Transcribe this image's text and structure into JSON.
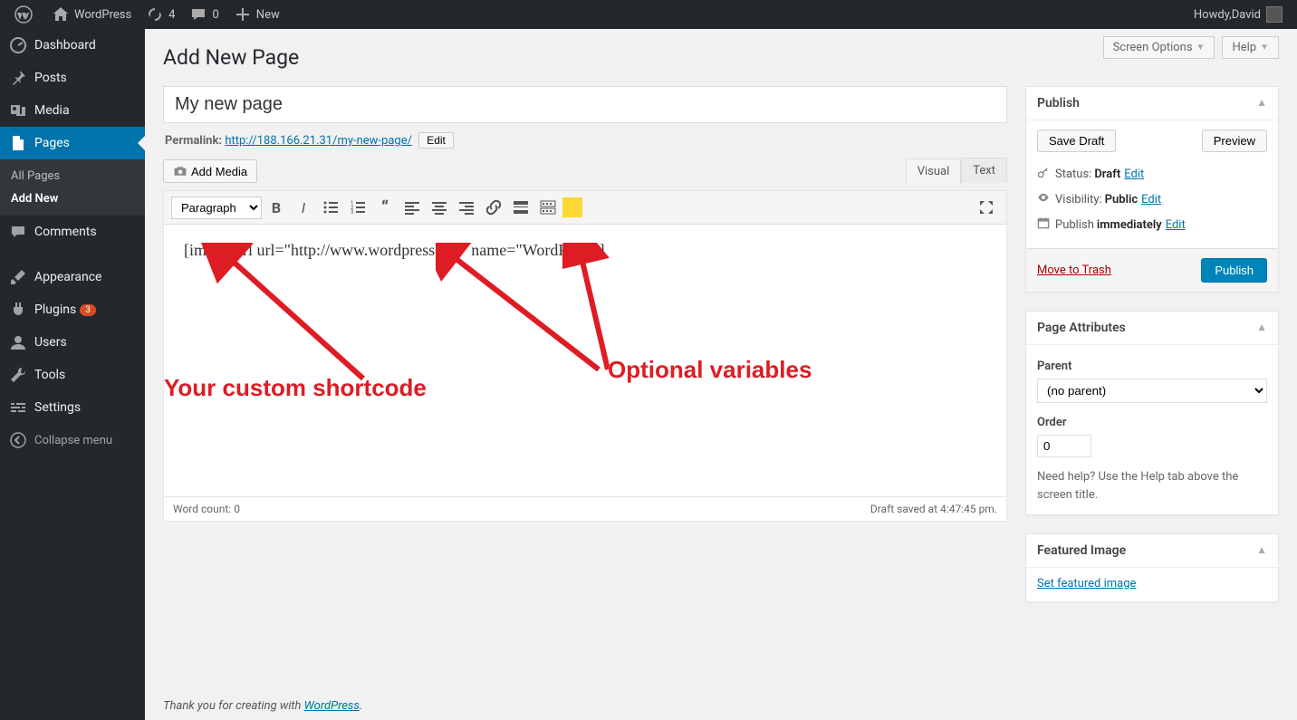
{
  "adminbar": {
    "site_name": "WordPress",
    "updates_count": "4",
    "comments_count": "0",
    "new_label": "New",
    "howdy_prefix": "Howdy, ",
    "user_name": "David"
  },
  "sidebar": {
    "dashboard": "Dashboard",
    "posts": "Posts",
    "media": "Media",
    "pages": "Pages",
    "pages_sub_all": "All Pages",
    "pages_sub_add": "Add New",
    "comments": "Comments",
    "appearance": "Appearance",
    "plugins": "Plugins",
    "plugins_badge": "3",
    "users": "Users",
    "tools": "Tools",
    "settings": "Settings",
    "collapse": "Collapse menu"
  },
  "screen_options": "Screen Options",
  "help_label": "Help",
  "page_heading": "Add New Page",
  "title_value": "My new page",
  "permalink_label": "Permalink:",
  "permalink_url": "http://188.166.21.31/my-new-page/",
  "permalink_edit": "Edit",
  "add_media": "Add Media",
  "tab_visual": "Visual",
  "tab_text": "Text",
  "format_dropdown": "Paragraph",
  "editor_content": "[image-url url=\"http://www.wordpress.org\" name=\"WordPress\"]",
  "annotation_left": "Your custom shortcode",
  "annotation_right": "Optional variables",
  "word_count_label": "Word count: ",
  "word_count": "0",
  "draft_saved": "Draft saved at 4:47:45 pm.",
  "publish": {
    "title": "Publish",
    "save_draft": "Save Draft",
    "preview": "Preview",
    "status_label": "Status:",
    "status_value": "Draft",
    "visibility_label": "Visibility:",
    "visibility_value": "Public",
    "schedule_label": "Publish",
    "schedule_value": "immediately",
    "edit": "Edit",
    "trash": "Move to Trash",
    "publish_btn": "Publish"
  },
  "attributes": {
    "title": "Page Attributes",
    "parent_label": "Parent",
    "parent_value": "(no parent)",
    "order_label": "Order",
    "order_value": "0",
    "help_text": "Need help? Use the Help tab above the screen title."
  },
  "featured": {
    "title": "Featured Image",
    "link": "Set featured image"
  },
  "footer_prefix": "Thank you for creating with ",
  "footer_link": "WordPress",
  "footer_suffix": "."
}
